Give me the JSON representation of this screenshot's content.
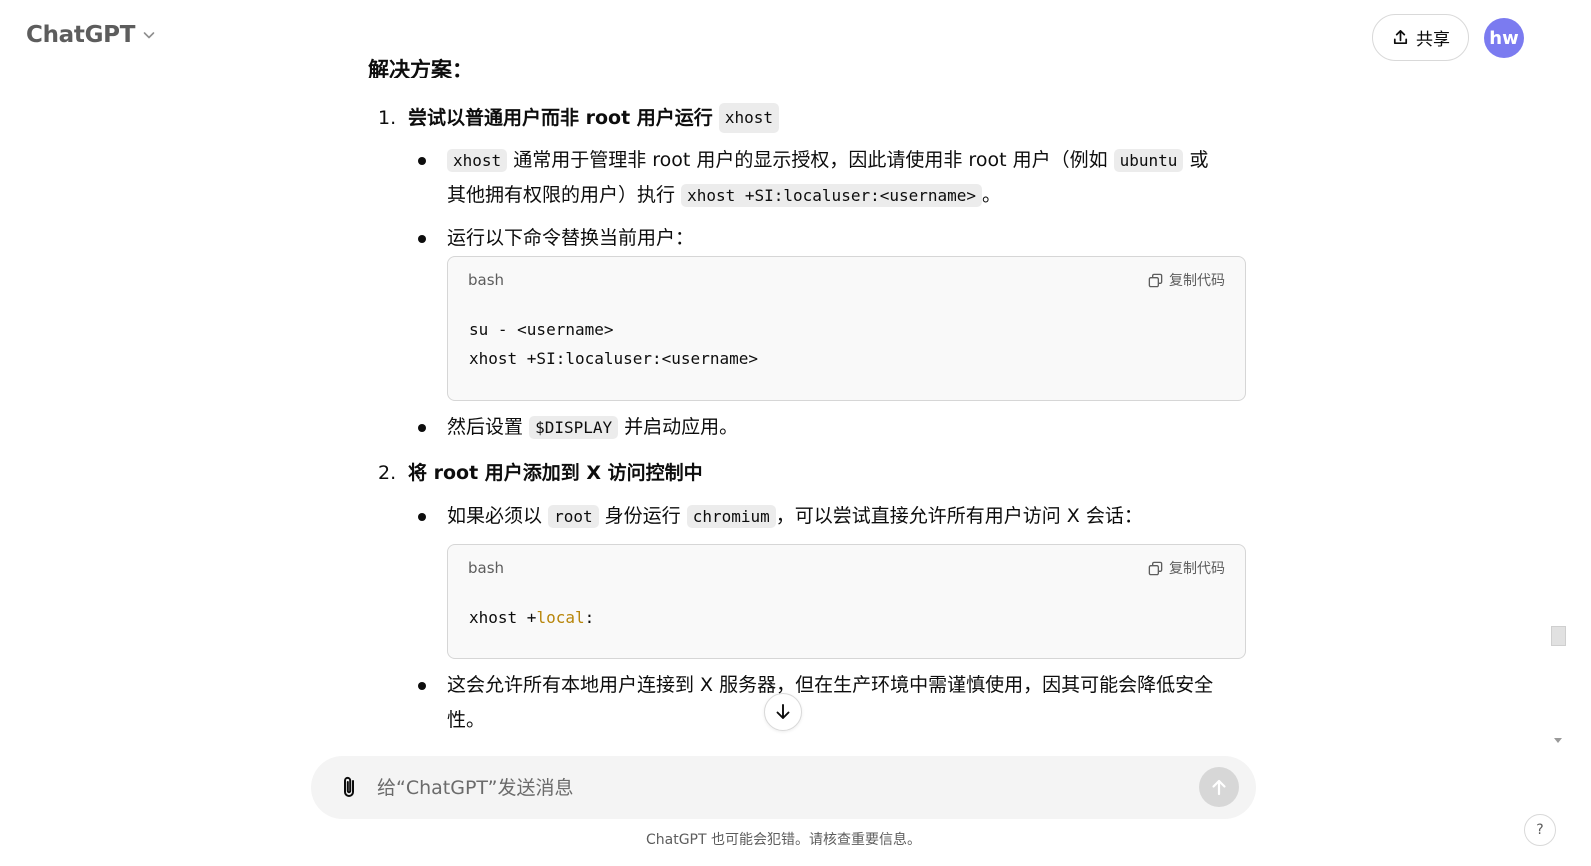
{
  "header": {
    "brand": "ChatGPT",
    "share_label": "共享",
    "avatar_initials": "hw",
    "avatar_color": "#7b7bf0"
  },
  "conversation": {
    "cut_heading": "解决方案：",
    "items": [
      {
        "number": "1.",
        "title_text": "尝试以普通用户而非 root 用户运行",
        "title_code": "xhost",
        "bullets": [
          {
            "code1": "xhost",
            "text1": "通常用于管理非 root 用户的显示授权，因此请使用非 root 用户（例如",
            "code2": "ubuntu",
            "text2": "或",
            "text3": "其他拥有权限的用户）执行",
            "code3": "xhost +SI:localuser:<username>",
            "text4": "。"
          },
          {
            "text": "运行以下命令替换当前用户："
          },
          {
            "text1": "然后设置",
            "code": "$DISPLAY",
            "text2": "并启动应用。"
          }
        ],
        "codeblock": {
          "lang": "bash",
          "copy_label": "复制代码",
          "line1": "su - <username>",
          "line2": "xhost +SI:localuser:<username>"
        }
      },
      {
        "number": "2.",
        "title": "将 root 用户添加到 X 访问控制中",
        "bullets": [
          {
            "text1": "如果必须以",
            "code1": "root",
            "text2": "身份运行",
            "code2": "chromium",
            "text3": "，可以尝试直接允许所有用户访问 X 会话："
          },
          {
            "text": "这会允许所有本地用户连接到 X 服务器，但在生产环境中需谨慎使用，因其可能会降低安全",
            "text_cont": "性。"
          }
        ],
        "codeblock": {
          "lang": "bash",
          "copy_label": "复制代码",
          "cmd": "xhost +",
          "keyword": "local",
          "suffix": ":"
        }
      }
    ]
  },
  "composer": {
    "placeholder": "给“ChatGPT”发送消息"
  },
  "footer": {
    "note": "ChatGPT 也可能会犯错。请核查重要信息。",
    "help": "?"
  }
}
